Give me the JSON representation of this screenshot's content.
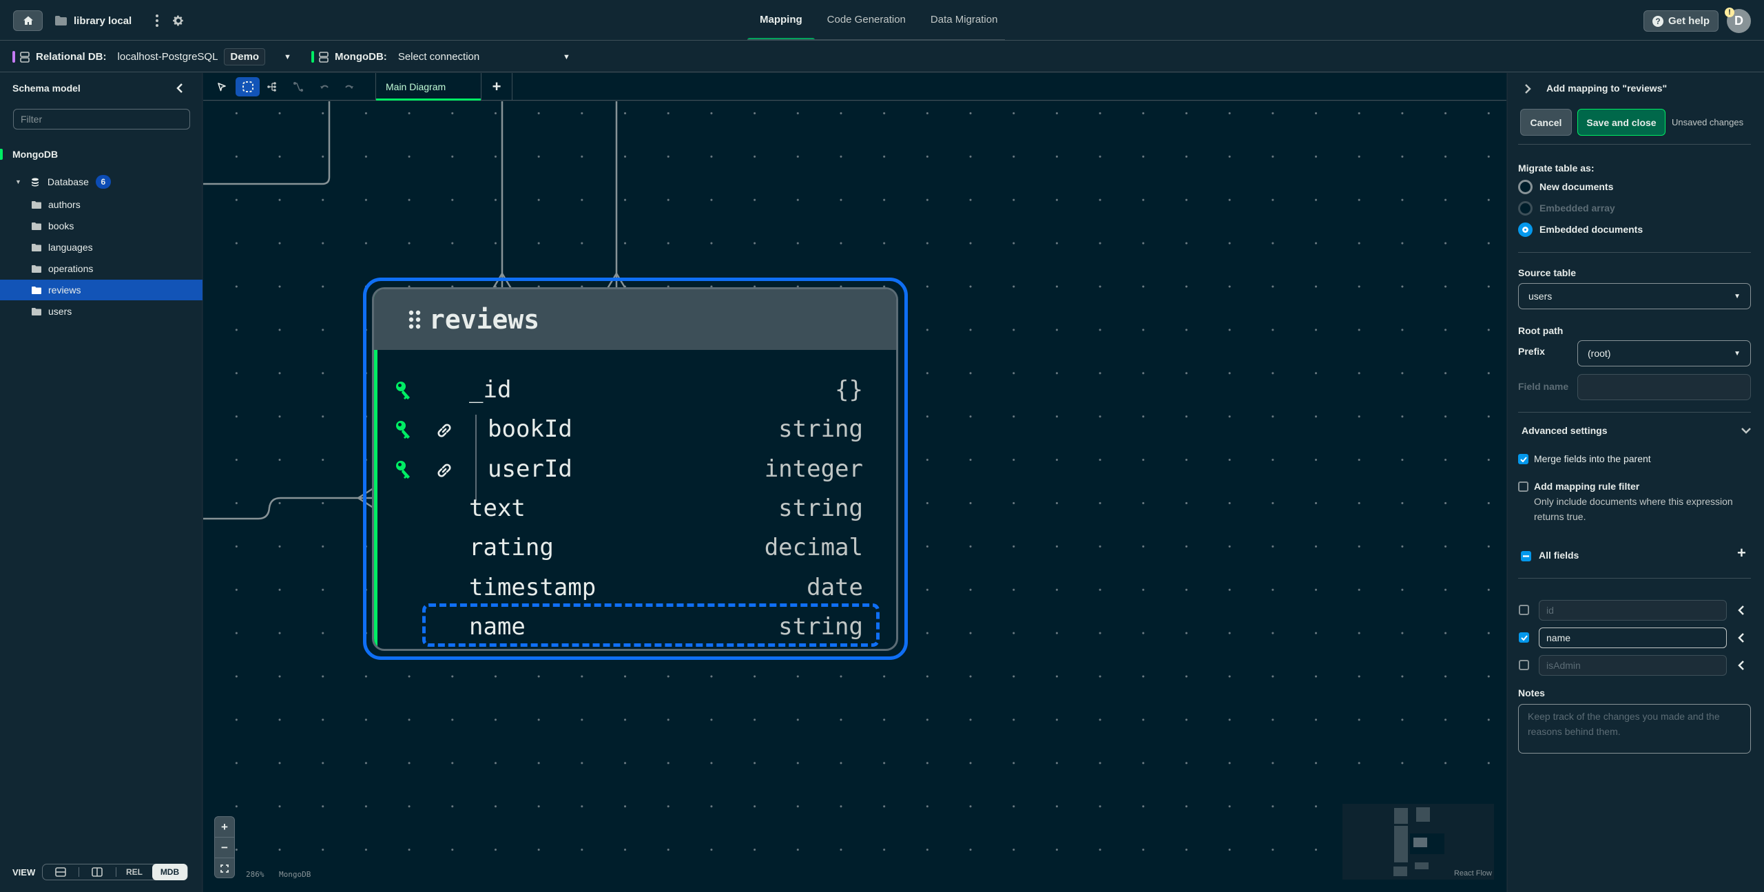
{
  "topbar": {
    "project_name": "library local",
    "tabs": [
      {
        "label": "Mapping",
        "active": true
      },
      {
        "label": "Code Generation",
        "active": false
      },
      {
        "label": "Data Migration",
        "active": false
      }
    ],
    "help_label": "Get help",
    "avatar_initial": "D",
    "avatar_badge": "!"
  },
  "connections": {
    "relational": {
      "label": "Relational DB:",
      "value": "localhost-PostgreSQL",
      "tag": "Demo",
      "accent": "#c47bf5"
    },
    "mongo": {
      "label": "MongoDB:",
      "value": "Select connection",
      "accent": "#00ed64"
    }
  },
  "sidebar": {
    "title": "Schema model",
    "filter_placeholder": "Filter",
    "section": "MongoDB",
    "database": {
      "label": "Database",
      "count": "6"
    },
    "items": [
      {
        "label": "authors",
        "selected": false
      },
      {
        "label": "books",
        "selected": false
      },
      {
        "label": "languages",
        "selected": false
      },
      {
        "label": "operations",
        "selected": false
      },
      {
        "label": "reviews",
        "selected": true
      },
      {
        "label": "users",
        "selected": false
      }
    ],
    "view": {
      "label": "VIEW",
      "options": [
        "REL",
        "MDB"
      ],
      "selected": "MDB"
    }
  },
  "canvas": {
    "diagram_tab": "Main Diagram",
    "zoom_level": "286%",
    "db_label": "MongoDB",
    "minimap_brand": "React Flow",
    "node": {
      "title": "reviews",
      "fields": [
        {
          "name": "_id",
          "type": "{}",
          "key": true,
          "link": false,
          "nested": false
        },
        {
          "name": "bookId",
          "type": "string",
          "key": true,
          "link": true,
          "nested": true
        },
        {
          "name": "userId",
          "type": "integer",
          "key": true,
          "link": true,
          "nested": true
        },
        {
          "name": "text",
          "type": "string",
          "key": false,
          "link": false,
          "nested": false
        },
        {
          "name": "rating",
          "type": "decimal",
          "key": false,
          "link": false,
          "nested": false
        },
        {
          "name": "timestamp",
          "type": "date",
          "key": false,
          "link": false,
          "nested": false
        },
        {
          "name": "name",
          "type": "string",
          "key": false,
          "link": false,
          "nested": false,
          "highlighted": true
        }
      ]
    }
  },
  "panel": {
    "title": "Add mapping to \"reviews\"",
    "cancel_label": "Cancel",
    "save_label": "Save and close",
    "unsaved_label": "Unsaved changes",
    "migrate_label": "Migrate table as:",
    "migrate_options": [
      {
        "label": "New documents",
        "state": "unchecked"
      },
      {
        "label": "Embedded array",
        "state": "disabled"
      },
      {
        "label": "Embedded documents",
        "state": "checked"
      }
    ],
    "source_table_label": "Source table",
    "source_table_value": "users",
    "root_path_label": "Root path",
    "prefix_label": "Prefix",
    "prefix_value": "(root)",
    "field_name_label": "Field name",
    "advanced_label": "Advanced settings",
    "merge_label": "Merge fields into the parent",
    "merge_checked": true,
    "filter_label": "Add mapping rule filter",
    "filter_checked": false,
    "filter_desc": "Only include documents where this expression returns true.",
    "all_fields_label": "All fields",
    "fields": [
      {
        "placeholder": "id",
        "value": "",
        "checked": false
      },
      {
        "placeholder": "name",
        "value": "name",
        "checked": true
      },
      {
        "placeholder": "isAdmin",
        "value": "",
        "checked": false
      }
    ],
    "notes_label": "Notes",
    "notes_placeholder": "Keep track of the changes you made and the reasons behind them."
  }
}
